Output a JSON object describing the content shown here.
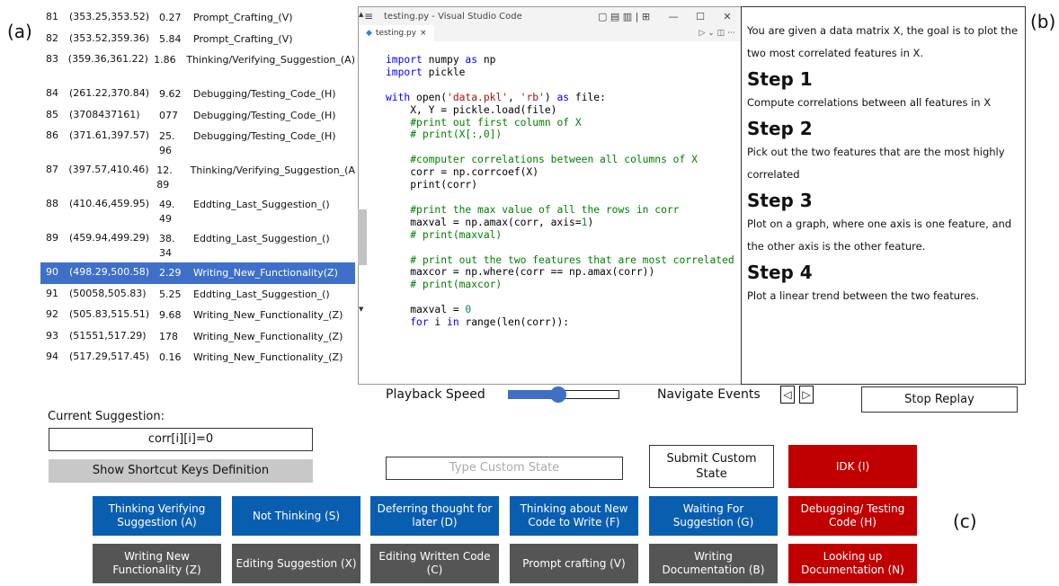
{
  "labels": {
    "a": "(a)",
    "b": "(b)",
    "c": "(c)"
  },
  "events": [
    {
      "id": "81",
      "range": "(353.25,353.52)",
      "dur": "0.27",
      "state": "Prompt_Crafting_(V)"
    },
    {
      "id": "82",
      "range": "(353.52,359.36)",
      "dur": "5.84",
      "state": "Prompt_Crafting_(V)"
    },
    {
      "id": "83",
      "range": "(359.36,361.22)",
      "dur": "1.86",
      "state": "Thinking/Verifying_Suggestion_(A)"
    },
    {
      "id": "84",
      "range": "(261.22,370.84)",
      "dur": "9.62",
      "state": "Debugging/Testing_Code_(H)"
    },
    {
      "id": "85",
      "range": "(3708437161)",
      "dur": "077",
      "state": "Debugging/Testing_Code_(H)"
    },
    {
      "id": "86",
      "range": "(371.61,397.57)",
      "dur": "25.96",
      "state": "Debugging/Testing_Code_(H)"
    },
    {
      "id": "87",
      "range": "(397.57,410.46)",
      "dur": "12.89",
      "state": "Thinking/Verifying_Suggestion_(A"
    },
    {
      "id": "88",
      "range": "(410.46,459.95)",
      "dur": "49.49",
      "state": "Eddting_Last_Suggestion_()"
    },
    {
      "id": "89",
      "range": "(459.94,499.29)",
      "dur": "38.34",
      "state": "Eddting_Last_Suggestion_()"
    },
    {
      "id": "90",
      "range": "(498.29,500.58)",
      "dur": "2.29",
      "state": "Writing_New_Functionality(Z)"
    },
    {
      "id": "91",
      "range": "(50058,505.83)",
      "dur": "5.25",
      "state": "Eddting_Last_Suggestion_()"
    },
    {
      "id": "92",
      "range": "(505.83,515.51)",
      "dur": "9.68",
      "state": "Writing_New_Functionality_(Z)"
    },
    {
      "id": "93",
      "range": "(51551,517.29)",
      "dur": "178",
      "state": "Writing_New_Functionality_(Z)"
    },
    {
      "id": "94",
      "range": "(517.29,517.45)",
      "dur": "0.16",
      "state": "Writing_New_Functionality_(Z)"
    }
  ],
  "current_suggestion": {
    "label": "Current Suggestion:",
    "value": "corr[i][i]=0"
  },
  "shortcut_button": "Show Shortcut Keys Definition",
  "vscode": {
    "title": "testing.py - Visual Studio Code",
    "tab": "testing.py",
    "tab_close": "×",
    "menu_icon": "≡",
    "controls": [
      "▢ ▤ ▥ | ⊞",
      "—",
      "☐",
      "✕"
    ],
    "tab_right": "▷ ⌄  ◫  ⋯"
  },
  "instructions": {
    "intro": "You are given a data matrix X, the goal is to plot the two most correlated features in X.",
    "steps": [
      {
        "title": "Step 1",
        "text": "Compute correlations between all features in X"
      },
      {
        "title": "Step 2",
        "text": "Pick out the two features that are the most highly correlated"
      },
      {
        "title": "Step 3",
        "text": "Plot on a graph, where one axis is one feature, and the other axis is the other feature."
      },
      {
        "title": "Step 4",
        "text": "Plot a linear trend between the two features."
      }
    ]
  },
  "controls": {
    "playback_label": "Playback Speed",
    "playback_speed_fraction": 0.45,
    "navigate_label": "Navigate Events",
    "prev": "◁",
    "next": "▷",
    "stop": "Stop Replay",
    "custom_placeholder": "Type Custom State",
    "submit": "Submit Custom State"
  },
  "states": [
    {
      "label": "IDK (I)",
      "color": "red"
    },
    {
      "label": "Thinking Verifying Suggestion (A)",
      "color": "blue"
    },
    {
      "label": "Not Thinking (S)",
      "color": "blue"
    },
    {
      "label": "Deferring thought for later (D)",
      "color": "blue"
    },
    {
      "label": "Thinking about New Code to Write (F)",
      "color": "blue"
    },
    {
      "label": "Waiting For Suggestion (G)",
      "color": "blue"
    },
    {
      "label": "Debugging/ Testing Code (H)",
      "color": "red"
    },
    {
      "label": "Writing New Functionality (Z)",
      "color": "gray"
    },
    {
      "label": "Editing Suggestion (X)",
      "color": "gray"
    },
    {
      "label": "Editing Written Code (C)",
      "color": "gray"
    },
    {
      "label": "Prompt crafting (V)",
      "color": "gray"
    },
    {
      "label": "Writing Documentation (B)",
      "color": "gray"
    },
    {
      "label": "Looking up Documentation (N)",
      "color": "red"
    }
  ]
}
